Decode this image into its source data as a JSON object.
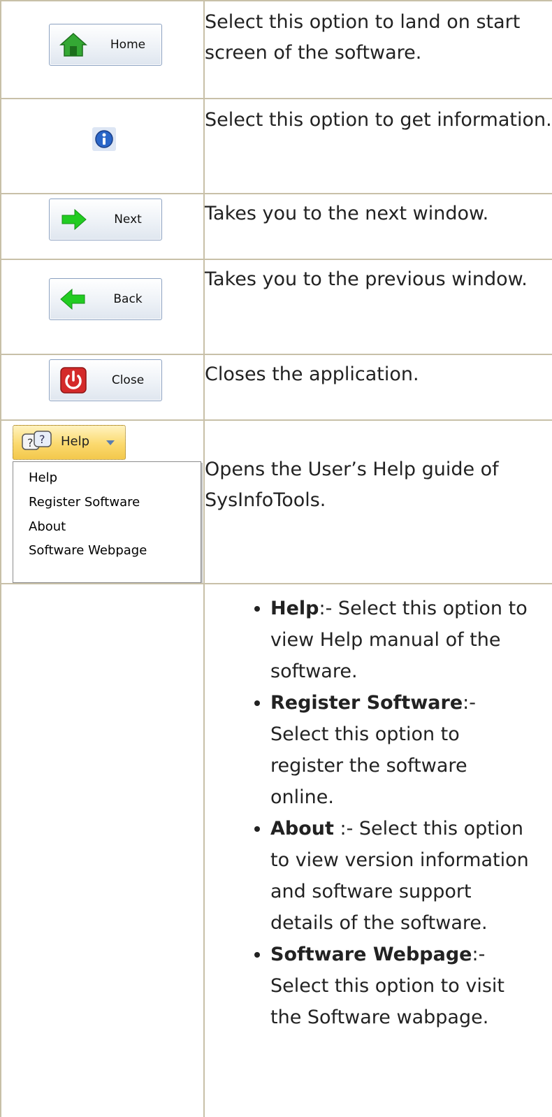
{
  "rows": [
    {
      "button": "Home",
      "text": "Select this option to land on start screen of the software."
    },
    {
      "button": "",
      "text": "Select this option to get information."
    },
    {
      "button": "Next",
      "text": "Takes you to the next window."
    },
    {
      "button": "Back",
      "text": "Takes you to the previous window."
    },
    {
      "button": "Close",
      "text": "Closes the application."
    }
  ],
  "help_row": {
    "button_label": "Help",
    "menu": [
      "Help",
      "Register Software",
      "About",
      "Software Webpage"
    ],
    "text": "Opens the User’s Help guide of SysInfoTools."
  },
  "bullets": [
    {
      "term": "Help",
      "sep": ":-",
      "text": " Select this option to view Help manual of the software."
    },
    {
      "term": "Register Software",
      "sep": ":-",
      "text": " Select this option to register the software online."
    },
    {
      "term": "About",
      "sep": " :-",
      "text": " Select this option to view version information and software support details of the software."
    },
    {
      "term": "Software Webpage",
      "sep": ":-",
      "text": " Select this option to visit the Software wabpage."
    }
  ],
  "colors": {
    "border": "#c8c0a8",
    "home_icon": "#2e9a2e",
    "arrow": "#22cc22",
    "close_icon": "#cc2222",
    "info_icon": "#2a66c8"
  },
  "icons": [
    "home-icon",
    "info-icon",
    "next-arrow-icon",
    "back-arrow-icon",
    "power-icon",
    "help-bubble-icon",
    "chevron-down-icon"
  ]
}
